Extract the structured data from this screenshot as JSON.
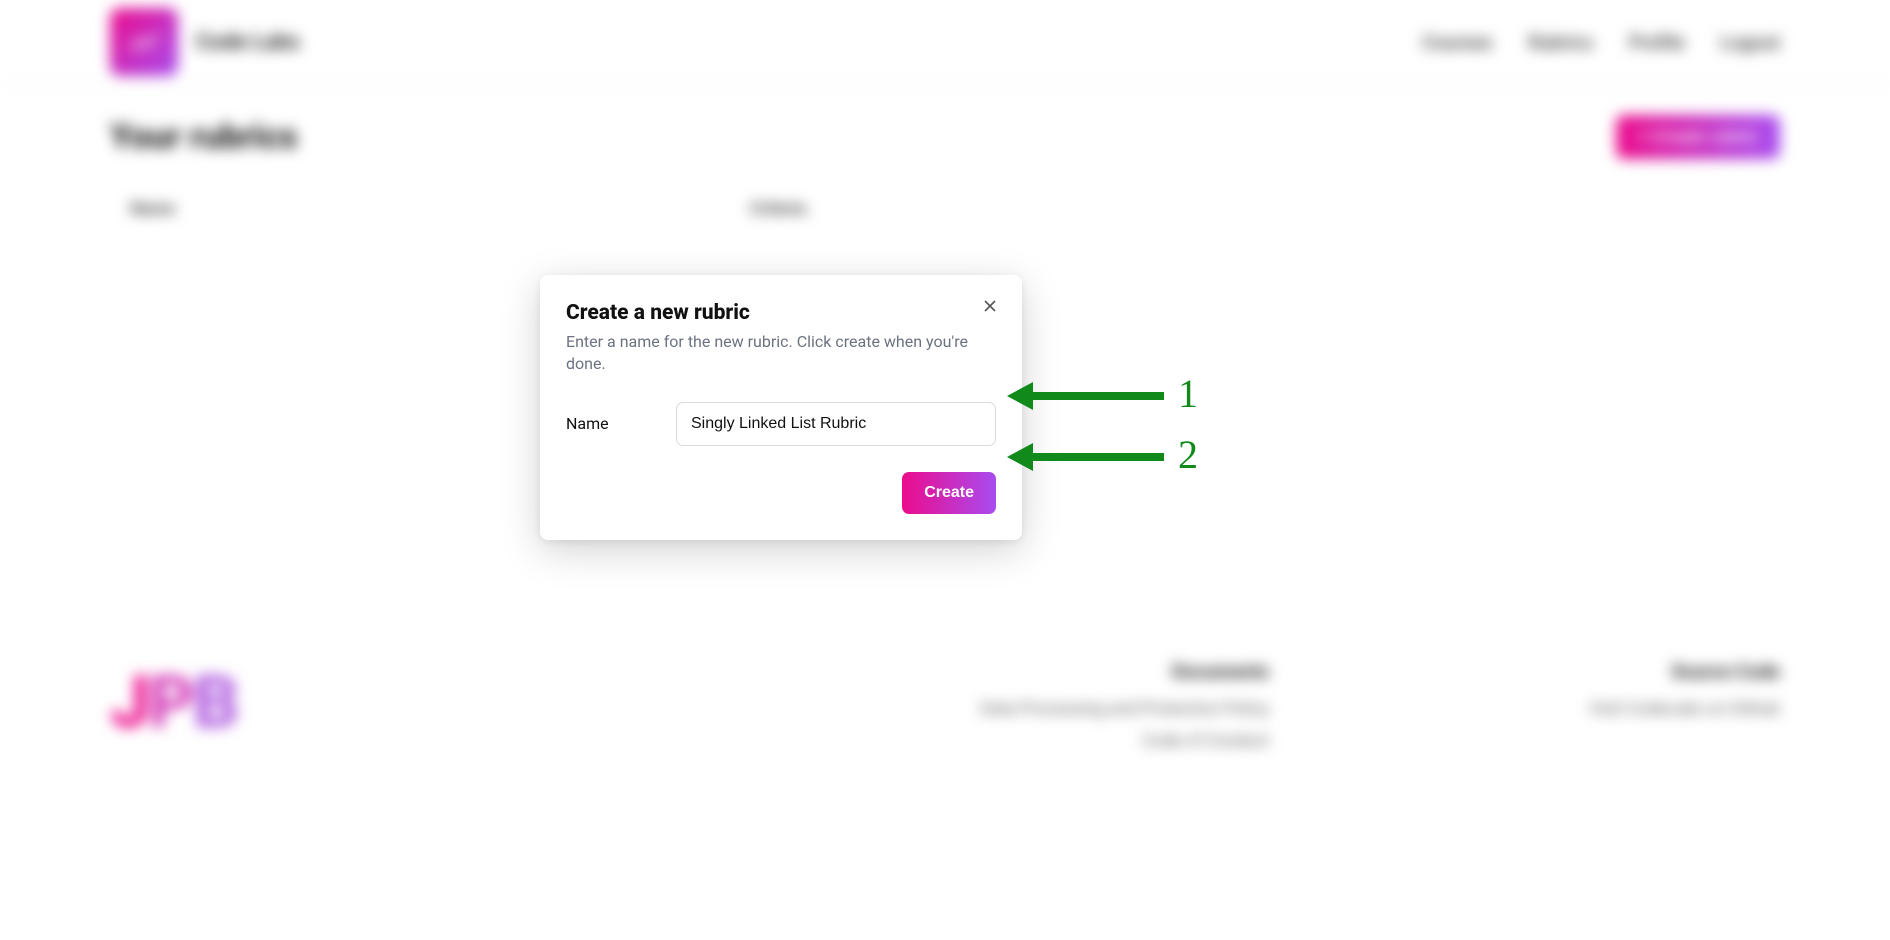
{
  "header": {
    "brand_name": "Code Labs",
    "nav": {
      "courses": "Courses",
      "rubrics": "Rubrics",
      "profile": "Profile",
      "logout": "Logout"
    }
  },
  "page": {
    "title": "Your rubrics",
    "create_button": "+ Create rubric",
    "table": {
      "col_name": "Name",
      "col_criteria": "Criteria"
    }
  },
  "footer": {
    "col1_title": "Documents",
    "col1_link1": "Data Processing and Protection Policy",
    "col1_link2": "Code of Conduct",
    "col2_title": "Source Code",
    "col2_link1": "Visit CodeLabs on Github"
  },
  "modal": {
    "title": "Create a new rubric",
    "description": "Enter a name for the new rubric. Click create when you're done.",
    "name_label": "Name",
    "name_value": "Singly Linked List Rubric",
    "create_label": "Create"
  },
  "annotations": {
    "one": "1",
    "two": "2"
  }
}
